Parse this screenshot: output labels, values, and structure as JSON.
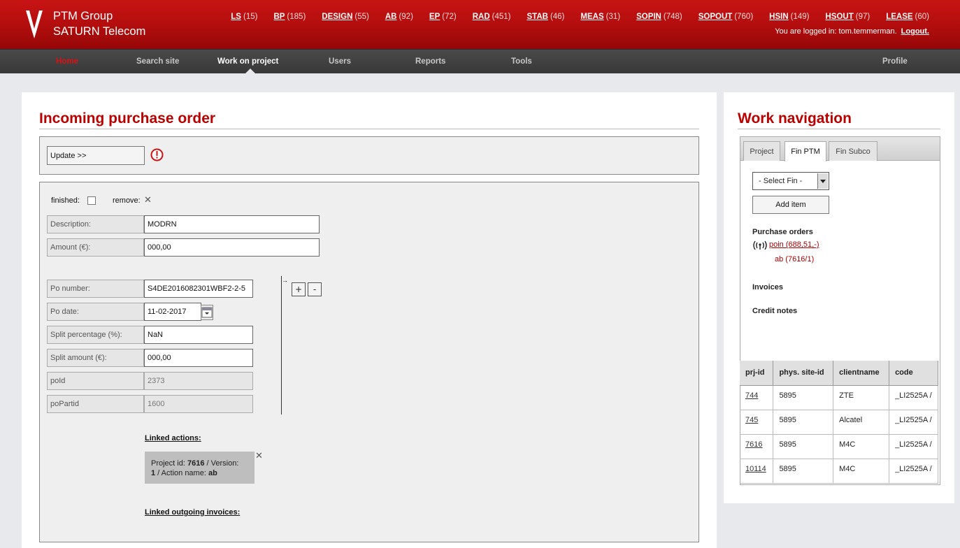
{
  "header": {
    "company_line1": "PTM Group",
    "company_line2": "SATURN Telecom",
    "counts": [
      {
        "label": "LS",
        "count": "(15)"
      },
      {
        "label": "BP",
        "count": "(185)"
      },
      {
        "label": "DESIGN",
        "count": "(55)"
      },
      {
        "label": "AB",
        "count": "(92)"
      },
      {
        "label": "EP",
        "count": "(72)"
      },
      {
        "label": "RAD",
        "count": "(451)"
      },
      {
        "label": "STAB",
        "count": "(46)"
      },
      {
        "label": "MEAS",
        "count": "(31)"
      },
      {
        "label": "SOPIN",
        "count": "(748)"
      },
      {
        "label": "SOPOUT",
        "count": "(760)"
      },
      {
        "label": "HSIN",
        "count": "(149)"
      },
      {
        "label": "HSOUT",
        "count": "(97)"
      },
      {
        "label": "LEASE",
        "count": "(60)"
      }
    ],
    "login_text": "You are logged in: tom.temmerman.",
    "logout_label": "Logout."
  },
  "nav": {
    "home": "Home",
    "search": "Search site",
    "work": "Work on project",
    "users": "Users",
    "reports": "Reports",
    "tools": "Tools",
    "profile": "Profile"
  },
  "main": {
    "title": "Incoming purchase order",
    "update_label": "Update  >>",
    "finished_label": "finished:",
    "remove_label": "remove:",
    "description_label": "Description:",
    "description_value": "MODRN",
    "amount_label": "Amount (€):",
    "amount_value": "000,00",
    "po_number_label": "Po number:",
    "po_number_value": "S4DE2016082301WBF2-2-5",
    "po_date_label": "Po date:",
    "po_date_value": "11-02-2017",
    "split_pct_label": "Split percentage (%):",
    "split_pct_value": "NaN",
    "split_amount_label": "Split amount (€):",
    "split_amount_value": "000,00",
    "poid_label": "poId",
    "poid_value": "2373",
    "popartid_label": "poPartid",
    "popartid_value": "1600",
    "plus_label": "+",
    "minus_label": "-",
    "linked_actions_label": "Linked actions:",
    "linked_project_prefix": "Project id: ",
    "linked_project_id": "7616",
    "linked_version_prefix": " / Version:",
    "linked_version": "1",
    "linked_action_prefix": " / Action name: ",
    "linked_action_name": "ab",
    "linked_invoices_label": "Linked outgoing invoices:"
  },
  "worknav": {
    "title": "Work navigation",
    "tabs": [
      "Project",
      "Fin PTM",
      "Fin Subco"
    ],
    "select_value": "- Select Fin -",
    "add_item_label": "Add item",
    "purchase_orders_label": "Purchase orders",
    "po_link": "poin (688,51,-)",
    "ab_link": "ab (7616/1)",
    "invoices_label": "Invoices",
    "credit_notes_label": "Credit notes",
    "table": {
      "headers": [
        "prj-id",
        "phys. site-id",
        "clientname",
        "code"
      ],
      "rows": [
        [
          "744",
          "5895",
          "ZTE",
          "_LI2525A /"
        ],
        [
          "745",
          "5895",
          "Alcatel",
          "_LI2525A /"
        ],
        [
          "7616",
          "5895",
          "M4C",
          "_LI2525A /"
        ],
        [
          "10114",
          "5895",
          "M4C",
          "_LI2525A /"
        ]
      ]
    }
  },
  "colors": {
    "brand_red": "#b00000",
    "nav_dark": "#404040"
  }
}
